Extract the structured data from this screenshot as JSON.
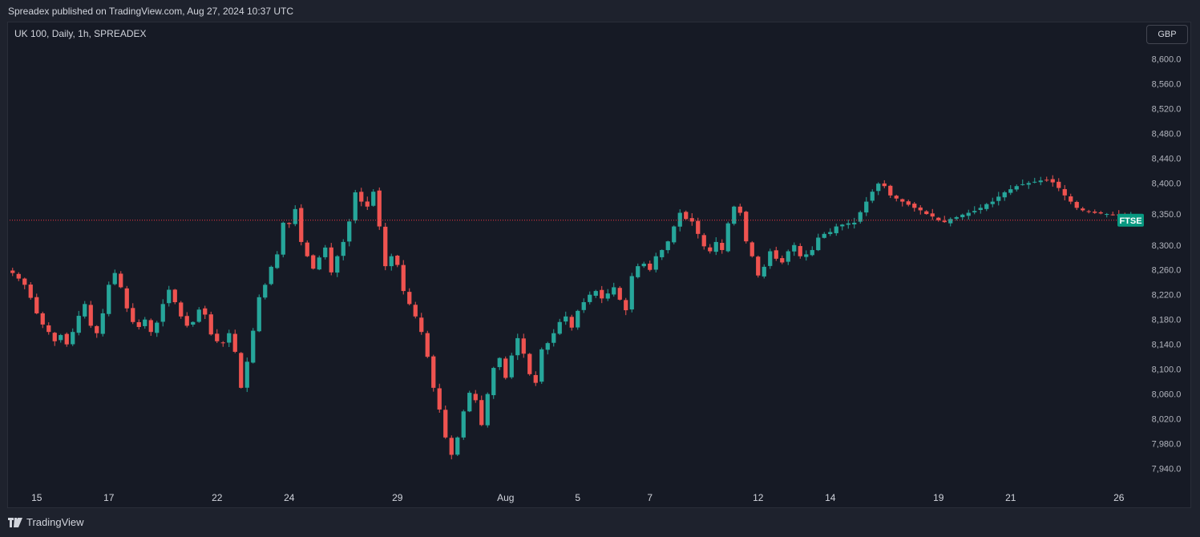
{
  "header": {
    "published_text": "Spreadex published on TradingView.com, Aug 27, 2024 10:37 UTC"
  },
  "chart_header": {
    "title": "UK 100, Daily, 1h, SPREADEX",
    "currency": "GBP"
  },
  "footer": {
    "brand": "TradingView"
  },
  "colors": {
    "up": "#26a69a",
    "down": "#ef5350",
    "label_bg": "#089981",
    "price_line": "#f23645"
  },
  "chart_data": {
    "type": "candlestick",
    "instrument": "UK 100",
    "interval": "1h",
    "currency": "GBP",
    "ylim": [
      7920,
      8620
    ],
    "y_ticks": [
      8600,
      8560,
      8520,
      8480,
      8440,
      8400,
      8350,
      8300,
      8260,
      8220,
      8180,
      8140,
      8100,
      8060,
      8020,
      7980,
      7940
    ],
    "y_tick_labels": [
      "8,600.0",
      "8,560.0",
      "8,520.0",
      "8,480.0",
      "8,440.0",
      "8,400.0",
      "8,350.0",
      "8,300.0",
      "8,260.0",
      "8,220.0",
      "8,180.0",
      "8,140.0",
      "8,100.0",
      "8,060.0",
      "8,020.0",
      "7,980.0",
      "7,940.0"
    ],
    "x_ticks": [
      {
        "label": "15",
        "index": 4
      },
      {
        "label": "17",
        "index": 16
      },
      {
        "label": "22",
        "index": 34
      },
      {
        "label": "24",
        "index": 46
      },
      {
        "label": "29",
        "index": 64
      },
      {
        "label": "Aug",
        "index": 82
      },
      {
        "label": "5",
        "index": 94
      },
      {
        "label": "7",
        "index": 106
      },
      {
        "label": "12",
        "index": 124
      },
      {
        "label": "14",
        "index": 136
      },
      {
        "label": "19",
        "index": 154
      },
      {
        "label": "21",
        "index": 166
      },
      {
        "label": "26",
        "index": 184
      }
    ],
    "closes": [
      8255,
      8246,
      8236,
      8215,
      8190,
      8172,
      8160,
      8145,
      8155,
      8140,
      8160,
      8186,
      8205,
      8170,
      8158,
      8190,
      8236,
      8255,
      8232,
      8198,
      8176,
      8168,
      8180,
      8160,
      8175,
      8205,
      8228,
      8208,
      8185,
      8170,
      8176,
      8196,
      8188,
      8156,
      8145,
      8142,
      8158,
      8128,
      8070,
      8112,
      8162,
      8216,
      8236,
      8265,
      8285,
      8336,
      8334,
      8358,
      8305,
      8282,
      8262,
      8280,
      8296,
      8256,
      8282,
      8305,
      8338,
      8385,
      8370,
      8362,
      8386,
      8330,
      8266,
      8282,
      8268,
      8226,
      8205,
      8185,
      8160,
      8120,
      8070,
      8035,
      7990,
      7962,
      7990,
      8032,
      8062,
      8050,
      8010,
      8060,
      8102,
      8118,
      8086,
      8122,
      8150,
      8125,
      8092,
      8078,
      8132,
      8142,
      8158,
      8176,
      8185,
      8167,
      8194,
      8208,
      8220,
      8226,
      8214,
      8222,
      8232,
      8212,
      8195,
      8250,
      8266,
      8270,
      8260,
      8282,
      8292,
      8306,
      8330,
      8352,
      8342,
      8338,
      8318,
      8298,
      8290,
      8305,
      8292,
      8335,
      8362,
      8352,
      8306,
      8282,
      8251,
      8265,
      8290,
      8278,
      8272,
      8290,
      8300,
      8282,
      8285,
      8292,
      8312,
      8318,
      8321,
      8330,
      8333,
      8335,
      8336,
      8353,
      8370,
      8386,
      8399,
      8395,
      8380,
      8375,
      8370,
      8365,
      8360,
      8356,
      8350,
      8346,
      8340,
      8337,
      8342,
      8345,
      8349,
      8352,
      8355,
      8360,
      8366,
      8370,
      8378,
      8385,
      8390,
      8395,
      8398,
      8400,
      8402,
      8404,
      8405,
      8401,
      8392,
      8380,
      8370,
      8360,
      8356,
      8354,
      8352,
      8351,
      8350,
      8349,
      8348,
      8347,
      8346,
      8345
    ],
    "last_label": "FTSE",
    "last_price": 8340
  }
}
